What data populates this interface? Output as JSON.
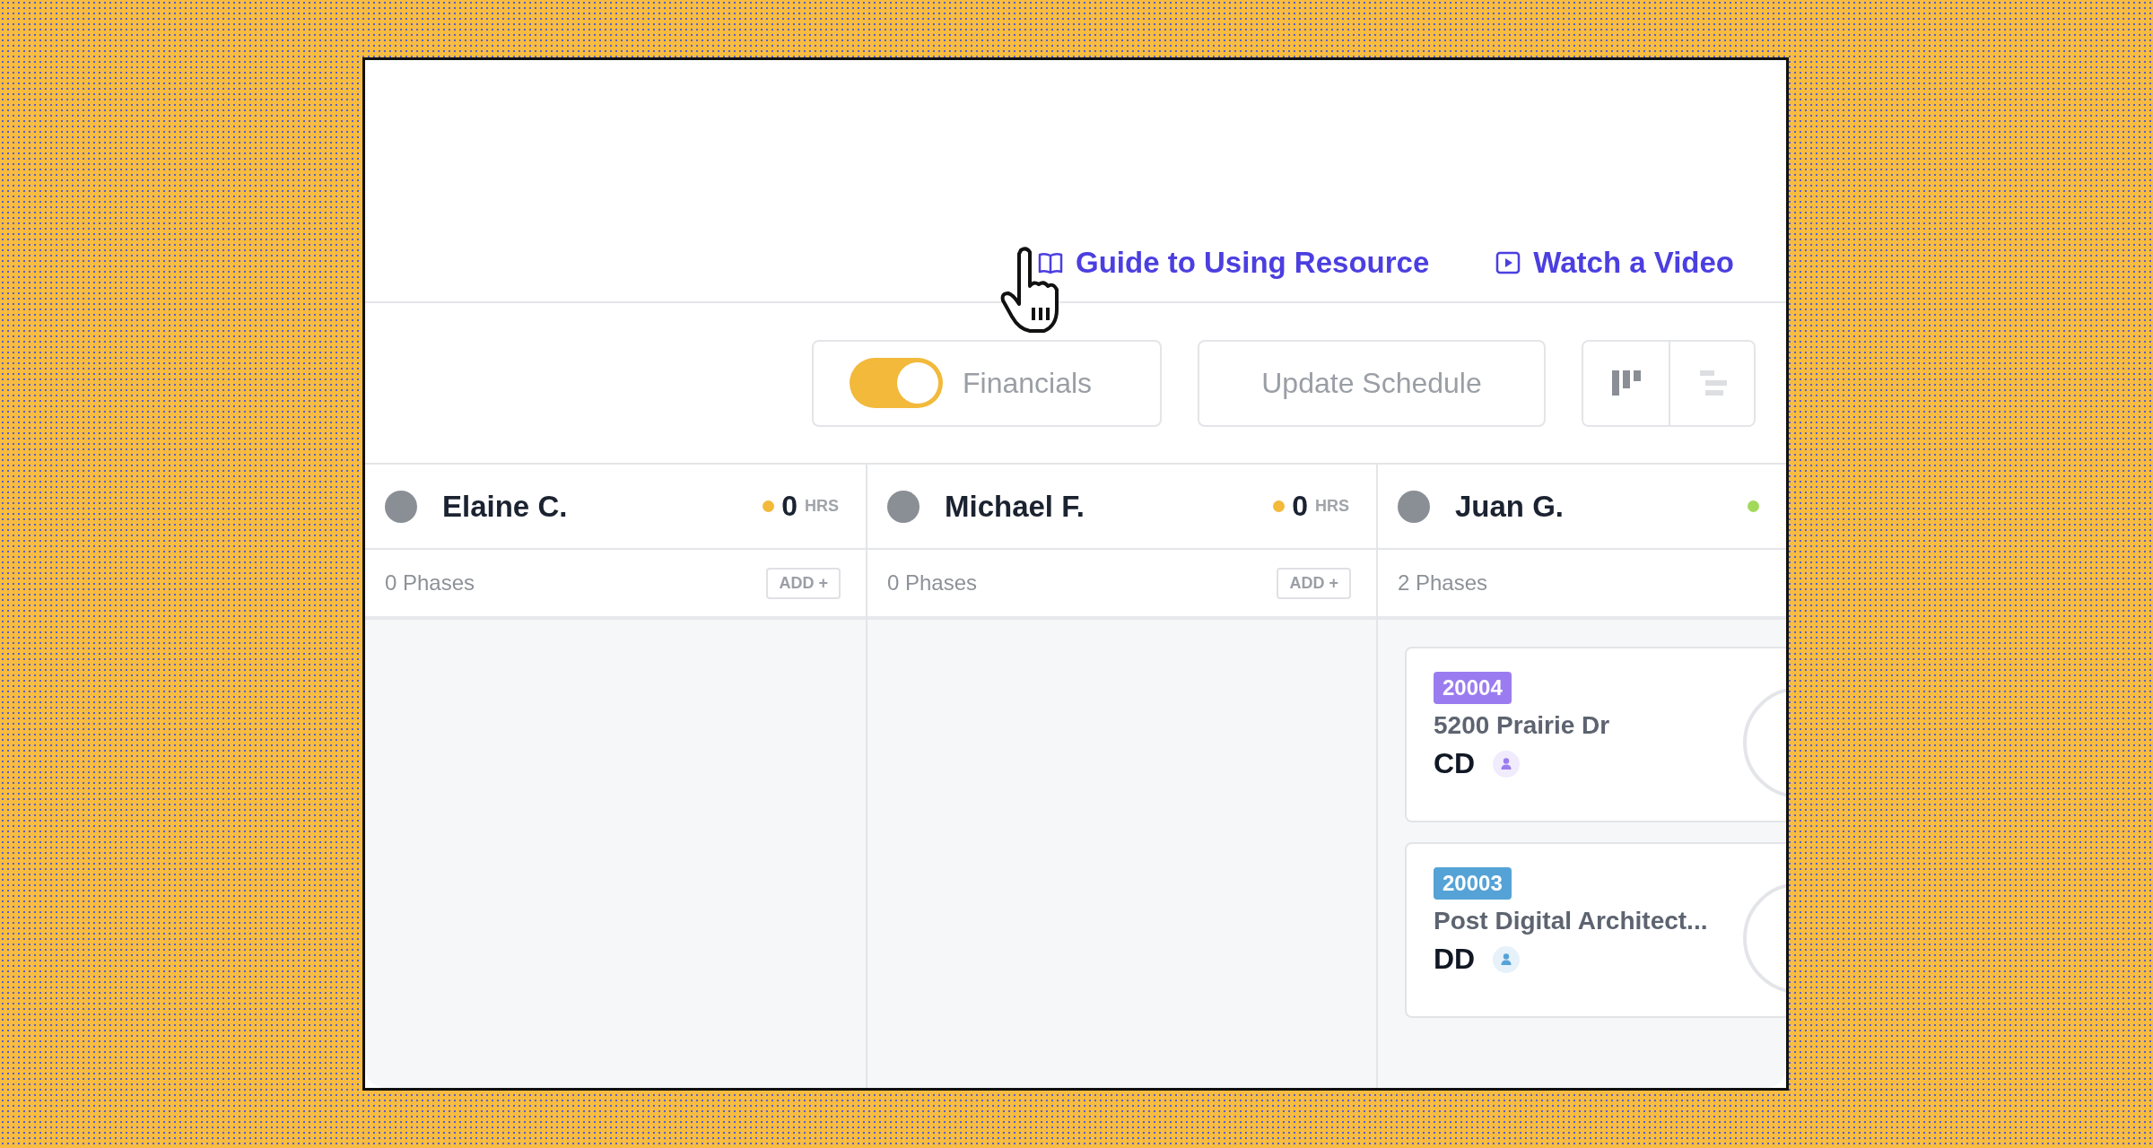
{
  "links": [
    {
      "kind": "guide",
      "label": "Guide to Using Resource"
    },
    {
      "kind": "video",
      "label": "Watch a Video"
    }
  ],
  "toolbar": {
    "financials": {
      "label": "Financials",
      "on": true
    },
    "update_button": "Update Schedule",
    "views": [
      {
        "kind": "board",
        "selected": true
      },
      {
        "kind": "gantt",
        "selected": false
      }
    ]
  },
  "columns": [
    {
      "name": "Elaine C.",
      "hours": "0",
      "hours_unit": "HRS",
      "color": "#f2b93b",
      "phases": "0 Phases",
      "add_label": "ADD +"
    },
    {
      "name": "Michael F.",
      "hours": "0",
      "hours_unit": "HRS",
      "color": "#f2b93b",
      "phases": "0 Phases",
      "add_label": "ADD +"
    },
    {
      "name": "Juan G.",
      "color": "#a3d95b",
      "phases": "2 Phases",
      "cards": [
        {
          "code": "20004",
          "color": "#9b7cf0",
          "title": "5200 Prairie Dr",
          "phase": "CD"
        },
        {
          "code": "20003",
          "color": "#55a3d6",
          "title": "Post Digital Architect...",
          "phase": "DD"
        }
      ]
    }
  ]
}
